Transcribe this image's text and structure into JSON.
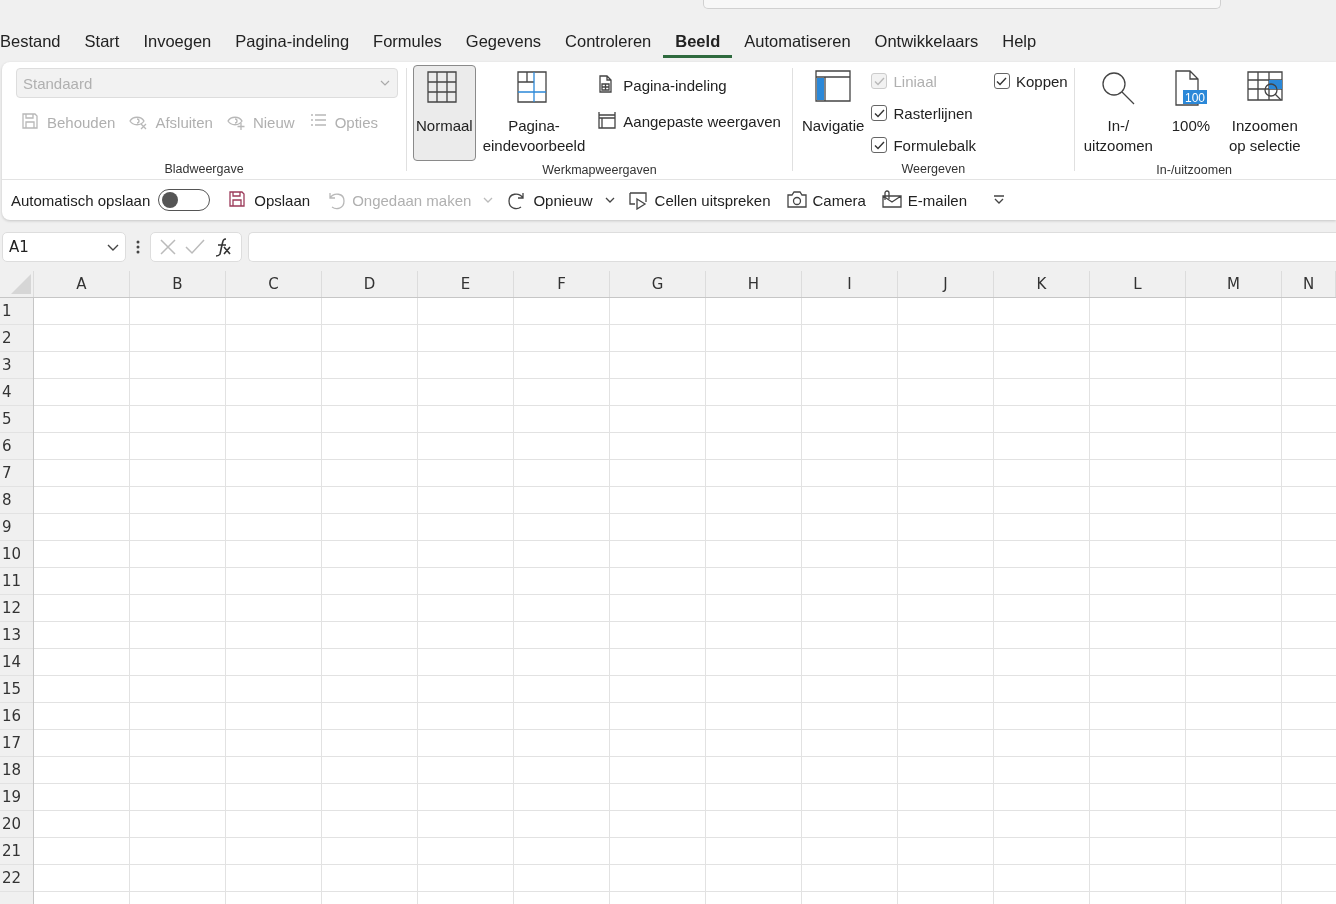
{
  "tabs": [
    {
      "label": "Bestand",
      "selected": false
    },
    {
      "label": "Start",
      "selected": false
    },
    {
      "label": "Invoegen",
      "selected": false
    },
    {
      "label": "Pagina-indeling",
      "selected": false
    },
    {
      "label": "Formules",
      "selected": false
    },
    {
      "label": "Gegevens",
      "selected": false
    },
    {
      "label": "Controleren",
      "selected": false
    },
    {
      "label": "Beeld",
      "selected": true
    },
    {
      "label": "Automatiseren",
      "selected": false
    },
    {
      "label": "Ontwikkelaars",
      "selected": false
    },
    {
      "label": "Help",
      "selected": false
    }
  ],
  "ribbon": {
    "groups": [
      {
        "label": "Bladweergave",
        "kind": "sheetview",
        "dropdown": {
          "placeholder": "Standaard",
          "disabled": true
        },
        "buttons": [
          {
            "label": "Behouden",
            "disabled": true
          },
          {
            "label": "Afsluiten",
            "disabled": true
          },
          {
            "label": "Nieuw",
            "disabled": true
          },
          {
            "label": "Opties",
            "disabled": true
          }
        ]
      },
      {
        "label": "Werkmapweergaven",
        "kind": "views",
        "large": [
          {
            "lines": [
              "Normaal"
            ],
            "selected": true
          },
          {
            "lines": [
              "Pagina-",
              "eindevoorbeeld"
            ],
            "selected": false
          }
        ],
        "small": [
          {
            "label": "Pagina-indeling"
          },
          {
            "label": "Aangepaste weergaven"
          }
        ]
      },
      {
        "label": "Weergeven",
        "kind": "show",
        "large": [
          {
            "lines": [
              "Navigatie"
            ]
          }
        ],
        "checks": [
          {
            "label": "Liniaal",
            "checked": true,
            "disabled": true
          },
          {
            "label": "Rasterlijnen",
            "checked": true,
            "disabled": false
          },
          {
            "label": "Formulebalk",
            "checked": true,
            "disabled": false
          },
          {
            "label": "Koppen",
            "checked": true,
            "disabled": false
          }
        ]
      },
      {
        "label": "In-/uitzoomen",
        "kind": "zoom",
        "large": [
          {
            "lines": [
              "In-/",
              "uitzoomen"
            ]
          },
          {
            "lines": [
              "100%"
            ],
            "badge": "100"
          },
          {
            "lines": [
              "Inzoomen",
              "op selectie"
            ]
          }
        ]
      }
    ]
  },
  "quick_access": {
    "autosave": {
      "label": "Automatisch opslaan",
      "on": false
    },
    "items": [
      {
        "label": "Opslaan",
        "disabled": false,
        "dropdown": false
      },
      {
        "label": "Ongedaan maken",
        "disabled": true,
        "dropdown": true
      },
      {
        "label": "Opnieuw",
        "disabled": false,
        "dropdown": true
      },
      {
        "label": "Cellen uitspreken",
        "disabled": false,
        "dropdown": false
      },
      {
        "label": "Camera",
        "disabled": false,
        "dropdown": false
      },
      {
        "label": "E-mailen",
        "disabled": false,
        "dropdown": false
      }
    ]
  },
  "formula_bar": {
    "name_box": "A1"
  },
  "grid": {
    "columns": [
      "A",
      "B",
      "C",
      "D",
      "E",
      "F",
      "G",
      "H",
      "I",
      "J",
      "K",
      "L",
      "M",
      "N"
    ],
    "rows": [
      "1",
      "2",
      "3",
      "4",
      "5",
      "6",
      "7",
      "8",
      "9",
      "10",
      "11",
      "12",
      "13",
      "14",
      "15",
      "16",
      "17",
      "18",
      "19",
      "20",
      "21",
      "22"
    ]
  }
}
